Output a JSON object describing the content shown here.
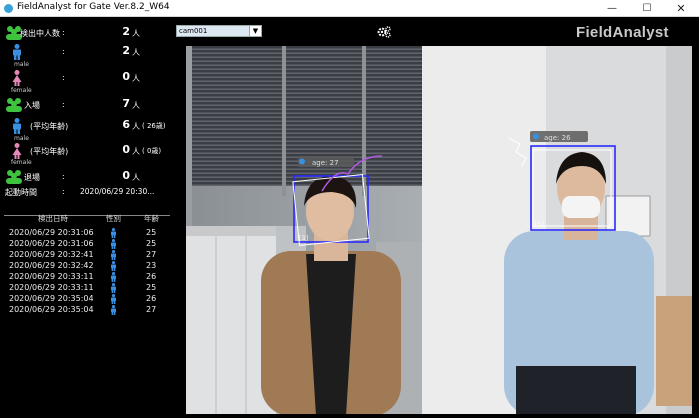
{
  "window": {
    "title": "FieldAnalyst for Gate Ver.8.2_W64",
    "minimize": "—",
    "maximize": "☐",
    "close": "✕"
  },
  "stats": {
    "detecting_label": "検出中人数",
    "detecting_value": "2",
    "unit": "人",
    "male_detect": "2",
    "female_detect": "0",
    "male_label": "male",
    "female_label": "female",
    "enter_label": "入場",
    "enter_value": "7",
    "avg_age_label": "(平均年齢)",
    "male_enter": "6",
    "male_avg": "( 26歳)",
    "female_enter": "0",
    "female_avg": "( 0歳)",
    "exit_label": "退場",
    "exit_value": "0",
    "start_label": "起動時間",
    "start_value": "2020/06/29 20:30...",
    "colon": ":"
  },
  "log": {
    "headers": [
      "検出日時",
      "性別",
      "年齢"
    ],
    "rows": [
      {
        "time": "2020/06/29 20:31:06",
        "age": "25"
      },
      {
        "time": "2020/06/29 20:31:06",
        "age": "25"
      },
      {
        "time": "2020/06/29 20:32:41",
        "age": "27"
      },
      {
        "time": "2020/06/29 20:32:42",
        "age": "23"
      },
      {
        "time": "2020/06/29 20:33:11",
        "age": "26"
      },
      {
        "time": "2020/06/29 20:33:11",
        "age": "25"
      },
      {
        "time": "2020/06/29 20:35:04",
        "age": "26"
      },
      {
        "time": "2020/06/29 20:35:04",
        "age": "27"
      }
    ]
  },
  "camera": {
    "selected": "cam001",
    "dropdown_arrow": "▼"
  },
  "brand": "FieldAnalyst",
  "detections": [
    {
      "label": "age: 27"
    },
    {
      "label": "age: 26"
    }
  ],
  "colors": {
    "male": "#3a8fe0",
    "female": "#e58ab8",
    "group": "#3ec33e",
    "box_blue": "#2a2aff"
  }
}
